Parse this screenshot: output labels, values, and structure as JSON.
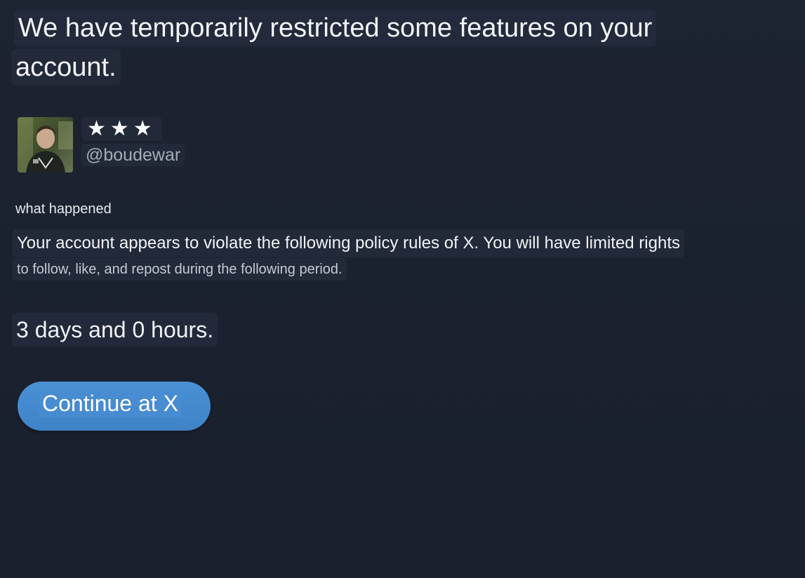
{
  "heading": {
    "line1": "We have temporarily restricted some features on your",
    "line2": "account."
  },
  "profile": {
    "stars": "★★★",
    "handle": "@boudewar",
    "avatar_icon": "profile-photo"
  },
  "details": {
    "section_label": "what happened",
    "message_line1": "Your account appears to violate the following policy rules of X. You will have limited rights",
    "message_line2": "to follow, like, and repost during the following period.",
    "duration": "3 days and 0 hours."
  },
  "actions": {
    "continue_label": "Continue at X"
  },
  "colors": {
    "background": "#1b2230",
    "button": "#4389cd",
    "text": "#f1f3f6",
    "muted_text": "#a4acb8"
  }
}
